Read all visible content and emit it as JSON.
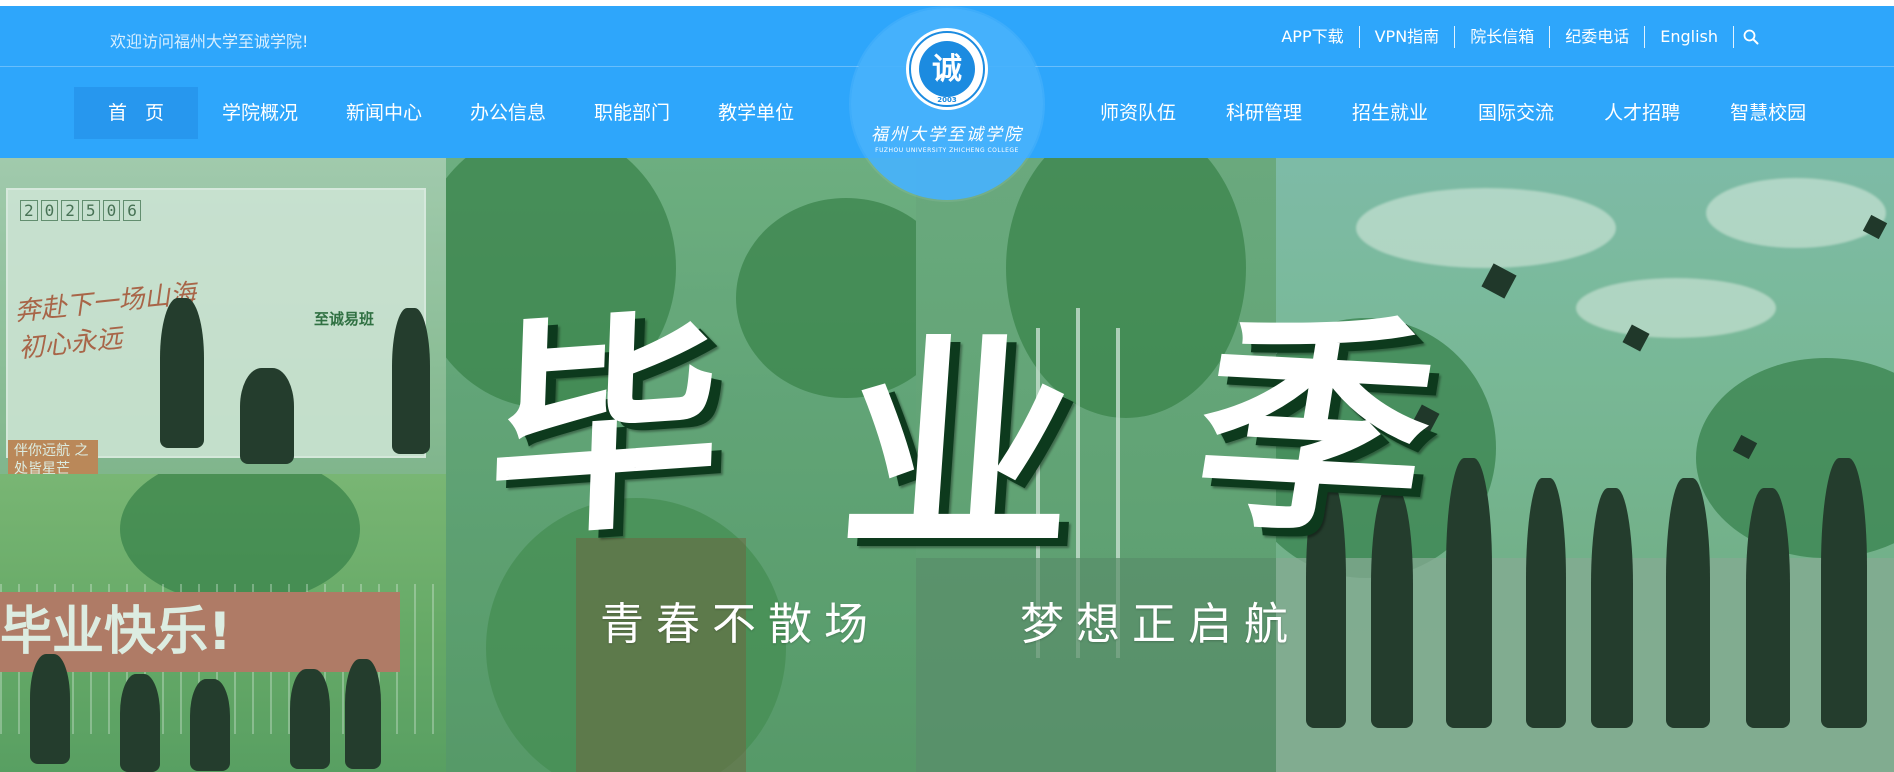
{
  "topbar": {
    "welcome": "欢迎访问福州大学至诚学院!",
    "links": [
      "APP下载",
      "VPN指南",
      "院长信箱",
      "纪委电话",
      "English"
    ]
  },
  "nav": {
    "left": [
      "首页",
      "学院概况",
      "新闻中心",
      "办公信息",
      "职能部门",
      "教学单位"
    ],
    "right": [
      "师资队伍",
      "科研管理",
      "招生就业",
      "国际交流",
      "人才招聘",
      "智慧校园"
    ],
    "active": "首页"
  },
  "logo": {
    "seal_char": "诚",
    "seal_year": "2003",
    "name_cn": "福州大学至诚学院",
    "name_en": "FUZHOU UNIVERSITY ZHICHENG COLLEGE"
  },
  "banner": {
    "headline": [
      "毕",
      "业",
      "季"
    ],
    "subline_left": "青春不散场",
    "subline_right": "梦想正启航",
    "photo_texts": {
      "date_code": [
        "2",
        "0",
        "2",
        "5",
        "0",
        "6"
      ],
      "slogan_line1": "奔赴下一场山海",
      "slogan_line2": "初心永远",
      "brand": "至诚易班",
      "tag": "伴你远航 之处皆星芒",
      "red_banner": "毕业快乐!"
    }
  },
  "colors": {
    "header_blue": "#2ea6fb",
    "active_nav": "#2797ee",
    "headline_shadow": "#0d3a1d"
  }
}
